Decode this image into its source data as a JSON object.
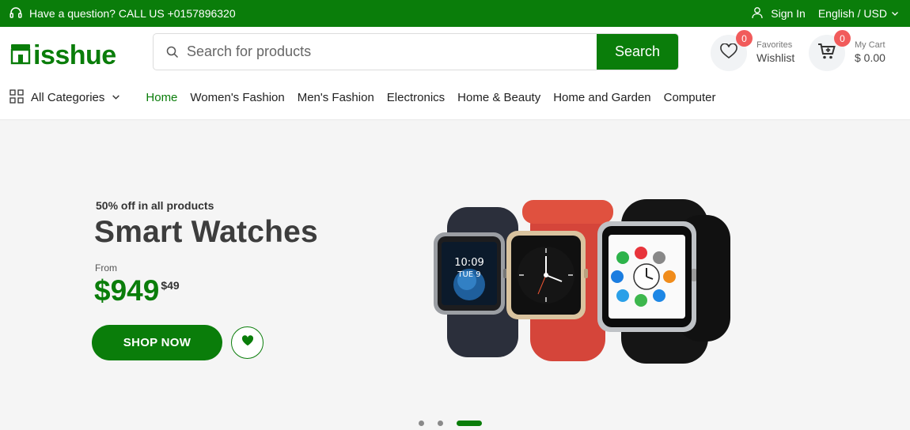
{
  "topbar": {
    "question": "Have a question? CALL US +0157896320",
    "signin": "Sign In",
    "language": "English / USD",
    "bg_color": "#0a7d0a",
    "icons": [
      "headset-icon",
      "user-icon",
      "chevron-down-icon"
    ]
  },
  "header": {
    "logo_text": "isshue",
    "search": {
      "placeholder": "Search for products",
      "value": "",
      "button_label": "Search"
    },
    "wishlist": {
      "small": "Favorites",
      "big": "Wishlist",
      "count": "0"
    },
    "cart": {
      "small": "My Cart",
      "big": "$ 0.00",
      "count": "0"
    }
  },
  "nav": {
    "all_categories": "All Categories",
    "items": [
      {
        "label": "Home",
        "active": true
      },
      {
        "label": "Women's Fashion"
      },
      {
        "label": "Men's Fashion"
      },
      {
        "label": "Electronics"
      },
      {
        "label": "Home & Beauty"
      },
      {
        "label": "Home and Garden"
      },
      {
        "label": "Computer"
      }
    ]
  },
  "hero": {
    "subtitle": "50% off in all products",
    "title": "Smart Watches",
    "from_label": "From",
    "price_main": "$949",
    "price_cents": "$49",
    "button_label": "SHOP NOW",
    "slides": 3,
    "active_slide": 3,
    "accent": "#0a7d0a"
  },
  "watch1": {
    "time": "10:09",
    "day": "TUE 9"
  }
}
